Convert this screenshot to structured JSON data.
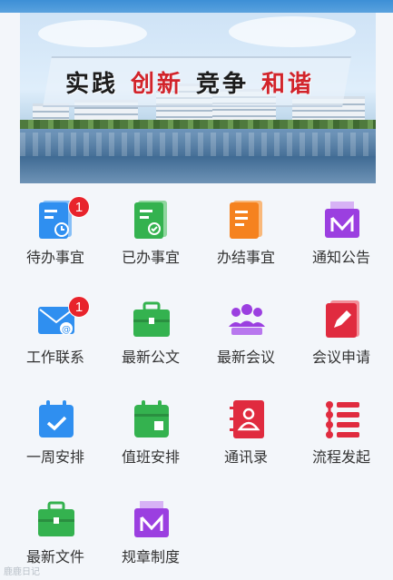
{
  "banner": {
    "slogan": [
      {
        "text": "实践",
        "color": "#1c1c1c"
      },
      {
        "text": "创新",
        "color": "#d2232a"
      },
      {
        "text": "竞争",
        "color": "#1c1c1c"
      },
      {
        "text": "和谐",
        "color": "#d2232a"
      }
    ]
  },
  "menu": [
    {
      "label": "待办事宜",
      "icon": "pending-clock-icon",
      "color": "#2f8ff0",
      "badge": "1"
    },
    {
      "label": "已办事宜",
      "icon": "done-check-doc-icon",
      "color": "#34b24f",
      "badge": ""
    },
    {
      "label": "办结事宜",
      "icon": "closed-doc-icon",
      "color": "#f5821f",
      "badge": ""
    },
    {
      "label": "通知公告",
      "icon": "notice-mail-icon",
      "color": "#9b3fe0",
      "badge": ""
    },
    {
      "label": "工作联系",
      "icon": "email-at-icon",
      "color": "#2f8ff0",
      "badge": "1"
    },
    {
      "label": "最新公文",
      "icon": "briefcase-icon",
      "color": "#34b24f",
      "badge": ""
    },
    {
      "label": "最新会议",
      "icon": "meeting-group-icon",
      "color": "#9b3fe0",
      "badge": ""
    },
    {
      "label": "会议申请",
      "icon": "edit-apply-icon",
      "color": "#e02b3f",
      "badge": ""
    },
    {
      "label": "一周安排",
      "icon": "calendar-check-icon",
      "color": "#2f8ff0",
      "badge": ""
    },
    {
      "label": "值班安排",
      "icon": "duty-calendar-icon",
      "color": "#34b24f",
      "badge": ""
    },
    {
      "label": "通讯录",
      "icon": "contacts-book-icon",
      "color": "#e02b3f",
      "badge": ""
    },
    {
      "label": "流程发起",
      "icon": "process-list-icon",
      "color": "#e02b3f",
      "badge": ""
    },
    {
      "label": "最新文件",
      "icon": "briefcase-icon",
      "color": "#34b24f",
      "badge": ""
    },
    {
      "label": "规章制度",
      "icon": "rules-mail-icon",
      "color": "#9b3fe0",
      "badge": ""
    }
  ],
  "watermark": "鹿鹿日记"
}
